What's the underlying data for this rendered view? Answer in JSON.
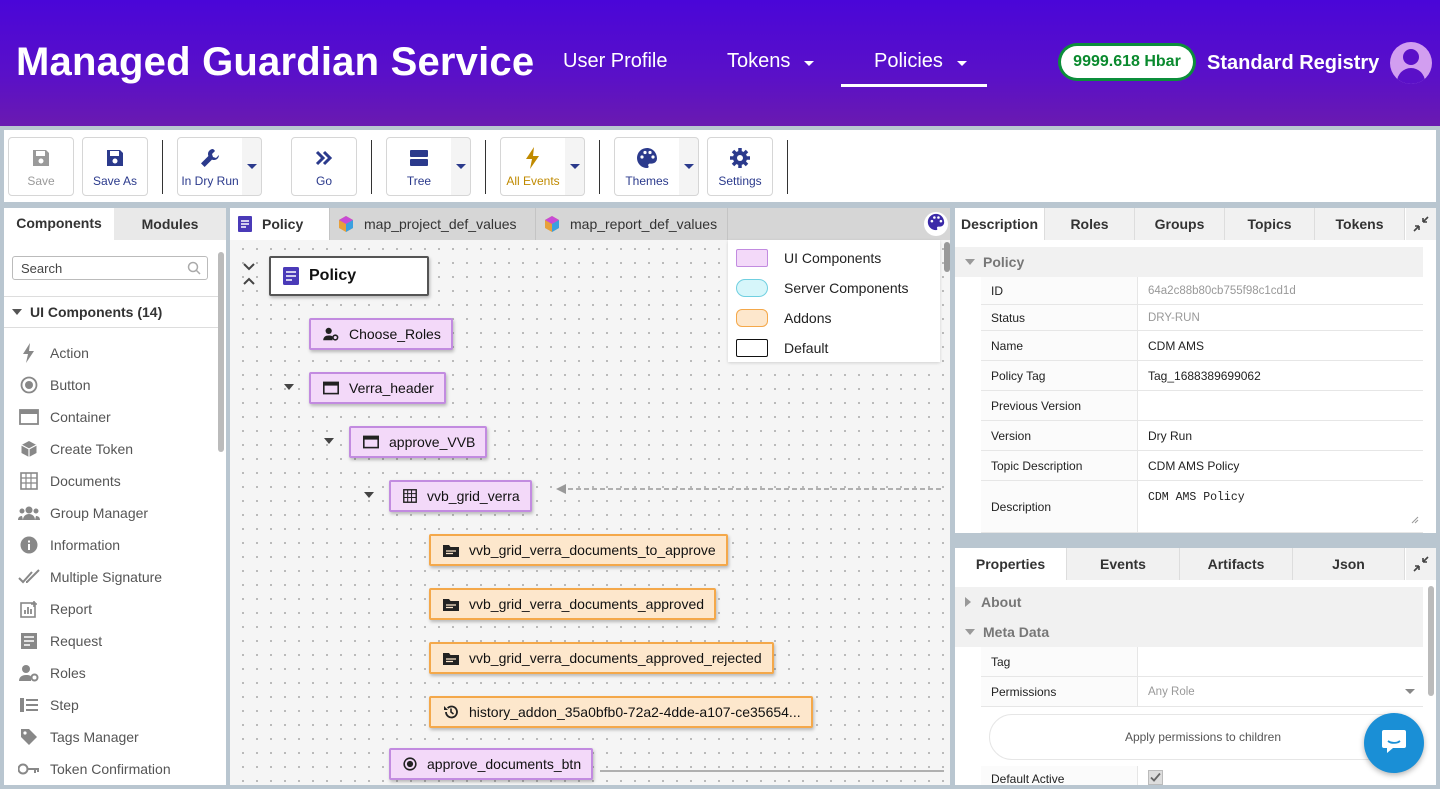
{
  "header": {
    "app_title": "Managed Guardian Service",
    "nav": {
      "user_profile": "User Profile",
      "tokens": "Tokens",
      "policies": "Policies"
    },
    "balance": "9999.618 Hbar",
    "role": "Standard Registry"
  },
  "toolbar": {
    "save": "Save",
    "save_as": "Save As",
    "dry_run": "In Dry Run",
    "go": "Go",
    "tree": "Tree",
    "all_events": "All Events",
    "themes": "Themes",
    "settings": "Settings"
  },
  "left": {
    "tabs": [
      "Components",
      "Modules"
    ],
    "search_placeholder": "Search",
    "section": "UI Components (14)",
    "items": [
      "Action",
      "Button",
      "Container",
      "Create Token",
      "Documents",
      "Group Manager",
      "Information",
      "Multiple Signature",
      "Report",
      "Request",
      "Roles",
      "Step",
      "Tags Manager",
      "Token Confirmation"
    ]
  },
  "center": {
    "tabs": [
      "Policy",
      "map_project_def_values",
      "map_report_def_values"
    ],
    "legend": [
      "UI Components",
      "Server Components",
      "Addons",
      "Default"
    ],
    "nodes": {
      "root": "Policy",
      "choose_roles": "Choose_Roles",
      "verra_header": "Verra_header",
      "approve_vvb": "approve_VVB",
      "vvb_grid_verra": "vvb_grid_verra",
      "docs_to_approve": "vvb_grid_verra_documents_to_approve",
      "docs_approved": "vvb_grid_verra_documents_approved",
      "docs_approved_rejected": "vvb_grid_verra_documents_approved_rejected",
      "history_addon": "history_addon_35a0bfb0-72a2-4dde-a107-ce35654...",
      "approve_btn": "approve_documents_btn"
    }
  },
  "description_panel": {
    "tabs": [
      "Description",
      "Roles",
      "Groups",
      "Topics",
      "Tokens"
    ],
    "section": "Policy",
    "rows": {
      "id_label": "ID",
      "id_value": "64a2c88b80cb755f98c1cd1d",
      "status_label": "Status",
      "status_value": "DRY-RUN",
      "name_label": "Name",
      "name_value": "CDM AMS",
      "tag_label": "Policy Tag",
      "tag_value": "Tag_1688389699062",
      "prev_label": "Previous Version",
      "prev_value": "",
      "version_label": "Version",
      "version_value": "Dry Run",
      "topic_label": "Topic Description",
      "topic_value": "CDM AMS Policy",
      "desc_label": "Description",
      "desc_value": "CDM AMS Policy"
    }
  },
  "properties_panel": {
    "tabs": [
      "Properties",
      "Events",
      "Artifacts",
      "Json"
    ],
    "about": "About",
    "meta": "Meta Data",
    "tag_label": "Tag",
    "permissions_label": "Permissions",
    "permissions_placeholder": "Any Role",
    "apply_btn": "Apply permissions to children",
    "default_active_label": "Default Active"
  },
  "colors": {
    "accent": "#4a06d8",
    "ui_node": "#f3d9f9",
    "addon_node": "#fde7cc",
    "balance": "#0c8e3b"
  }
}
